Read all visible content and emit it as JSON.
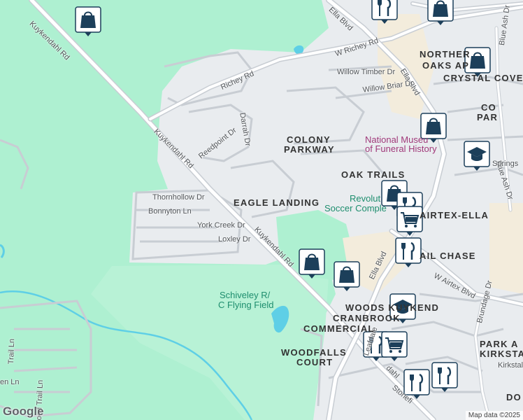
{
  "colors": {
    "water": "#5ecfe6",
    "park": "#aef0d1",
    "road": "#ffffff",
    "road_outline": "#c8cdd3",
    "land": "#e9ecef",
    "marker_fill": "#1c3f5a"
  },
  "roads": {
    "kuykendahl_rd_top": "Kuykendahl Rd",
    "kuykendahl_rd_mid": "Kuykendahl Rd",
    "kuykendahl_rd_low": "Kuykendahl Rd",
    "richey_rd": "Richey Rd",
    "w_richey_rd": "W Richey Rd",
    "ella_blvd_top": "Ella Blvd",
    "ella_blvd_mid": "Ella Blvd",
    "ella_blvd_low": "Ella Blvd",
    "willow_timber_dr": "Willow Timber Dr",
    "willow_briar_dr": "Willow Briar Dr",
    "darrah_dr": "Darrah Dr",
    "reedpoint_dr": "Reedpoint Dr",
    "thornhollow_dr": "Thornhollow Dr",
    "bonnyton_ln": "Bonnyton Ln",
    "york_creek_dr": "York Creek Dr",
    "loxley_dr": "Loxley Dr",
    "w_airtex_blvd": "W Airtex Blvd",
    "blue_ash_dr_top": "Blue Ash Dr",
    "blue_ash_dr_mid": "Blue Ash Dr",
    "springs": "Springs",
    "brundage_dr": "Brundage Dr",
    "leafdale": "Leafdale",
    "stonefi": "Stonefi",
    "kirkstal": "Kirkstal",
    "dahl": "dahl",
    "trail_ln": "Trail Ln",
    "wood_trail_ln": "ood Trail Ln",
    "en_ln": "en Ln"
  },
  "areas": {
    "northern_oaks_1": "NORTHER",
    "northern_oaks_2": "OAKS AP",
    "crystal_cove": "CRYSTAL COVE",
    "colony_parkway_1": "COLONY",
    "colony_parkway_2": "PARKWAY",
    "co_park_1": "CO",
    "co_park_2": "PAR",
    "oak_trails": "OAK TRAILS",
    "eagle_landing": "EAGLE LANDING",
    "airtex_ella": "AIRTEX-ELLA",
    "trail_chase": "AIL CHASE",
    "woods_kuykendahl": "WOODS KUYKEND",
    "cranbrook_1": "CRANBROOK",
    "cranbrook_2": "COMMERCIAL",
    "woodfalls_1": "WOODFALLS",
    "woodfalls_2": "COURT",
    "park_kirkstall_1": "PARK A",
    "park_kirkstall_2": "KIRKSTA",
    "do": "DO"
  },
  "pois": {
    "museum_1": "National Museu",
    "museum_2": "of Funeral History",
    "soccer_1": "Revolut",
    "soccer_2": "Soccer Comple",
    "flying_field_1": "Schiveley R/",
    "flying_field_2": "C Flying Field"
  },
  "markers": [
    {
      "name": "shopping-bag-marker",
      "icon": "shopping-bag-icon"
    },
    {
      "name": "restaurant-marker",
      "icon": "fork-knife-icon"
    },
    {
      "name": "shopping-bag-marker",
      "icon": "shopping-bag-icon"
    },
    {
      "name": "shopping-bag-marker",
      "icon": "shopping-bag-icon"
    },
    {
      "name": "shopping-bag-marker",
      "icon": "shopping-bag-icon"
    },
    {
      "name": "school-marker",
      "icon": "graduation-cap-icon"
    },
    {
      "name": "shopping-bag-marker",
      "icon": "shopping-bag-icon"
    },
    {
      "name": "restaurant-marker",
      "icon": "fork-knife-icon"
    },
    {
      "name": "shopping-cart-marker",
      "icon": "shopping-cart-icon"
    },
    {
      "name": "restaurant-marker",
      "icon": "fork-knife-icon"
    },
    {
      "name": "shopping-bag-marker",
      "icon": "shopping-bag-icon"
    },
    {
      "name": "shopping-bag-marker",
      "icon": "shopping-bag-icon"
    },
    {
      "name": "school-marker",
      "icon": "graduation-cap-icon"
    },
    {
      "name": "restaurant-marker",
      "icon": "fork-knife-icon"
    },
    {
      "name": "shopping-cart-marker",
      "icon": "shopping-cart-icon"
    },
    {
      "name": "restaurant-marker",
      "icon": "fork-knife-icon"
    },
    {
      "name": "restaurant-marker",
      "icon": "fork-knife-icon"
    }
  ],
  "brand": "Google",
  "attribution": "Map data ©2025"
}
